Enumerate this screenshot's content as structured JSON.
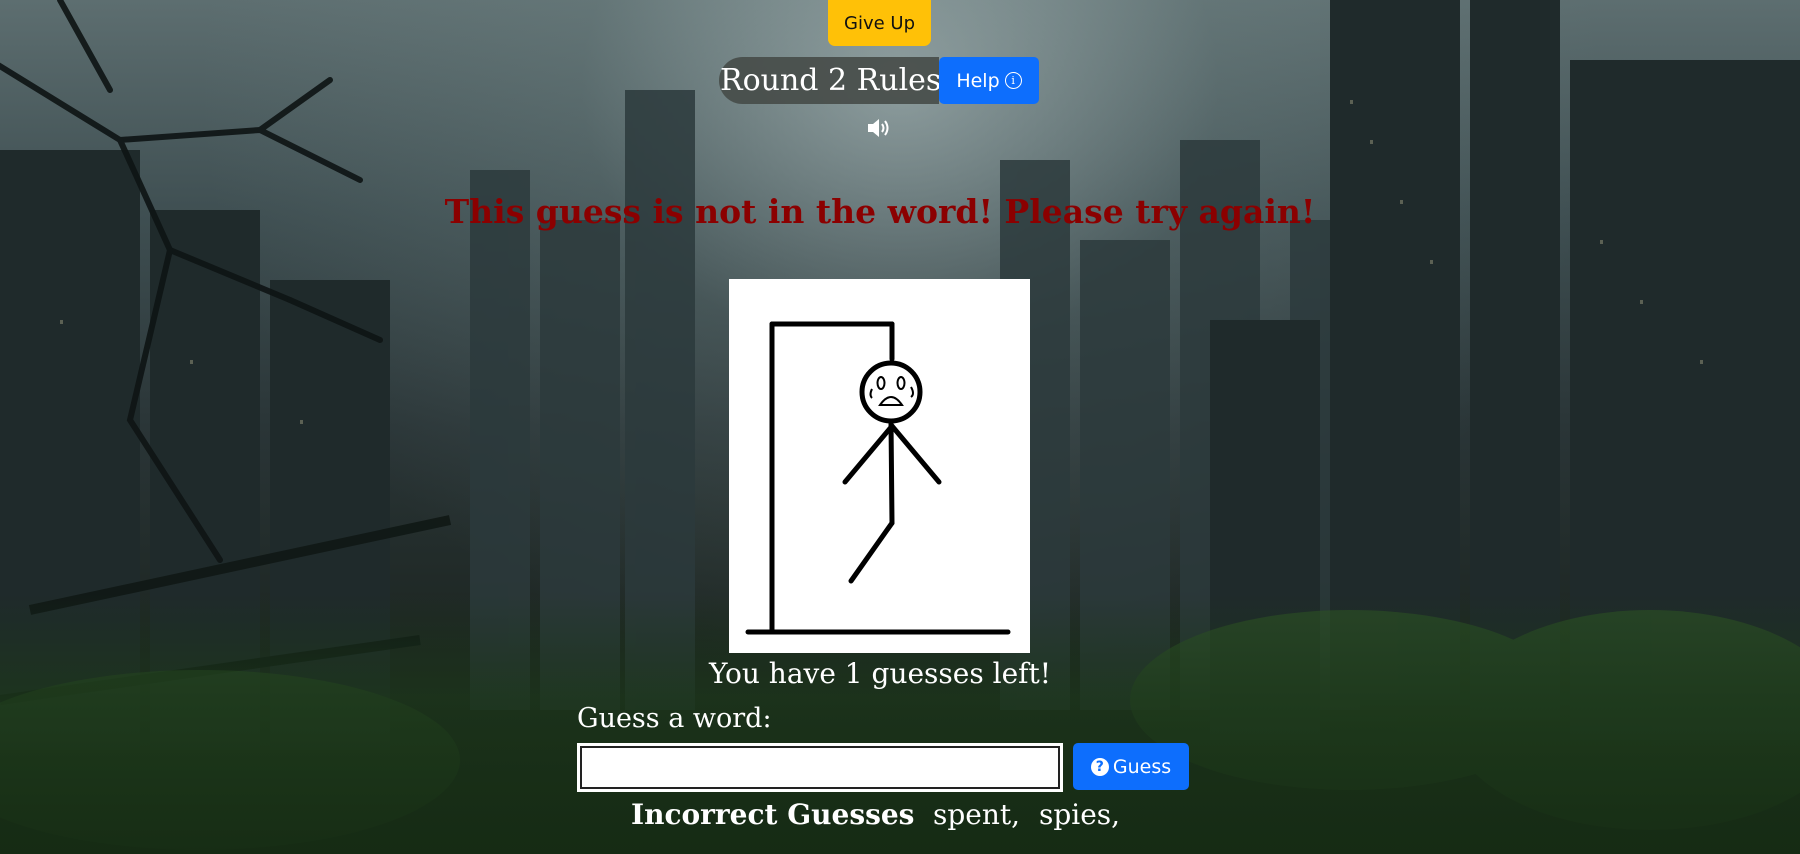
{
  "header": {
    "give_up_label": "Give Up",
    "round_title": "Round 2 Rules -",
    "help_label": "Help",
    "help_icon": "info-circle-icon",
    "sound_icon": "volume-up-icon"
  },
  "game": {
    "feedback": "This guess is not in the word! Please try again!",
    "feedback_color": "#8b0000",
    "guesses_remaining": 1,
    "guesses_left_text": "You have 1 guesses left!",
    "guess_label": "Guess a word:",
    "guess_input_value": "",
    "guess_button_label": "Guess",
    "guess_button_icon": "question-circle-icon",
    "incorrect_label": "Incorrect Guesses",
    "incorrect_guesses": [
      "spent,",
      "spies,"
    ]
  },
  "colors": {
    "give_up_bg": "#ffc107",
    "primary_button": "#0d6efd"
  }
}
